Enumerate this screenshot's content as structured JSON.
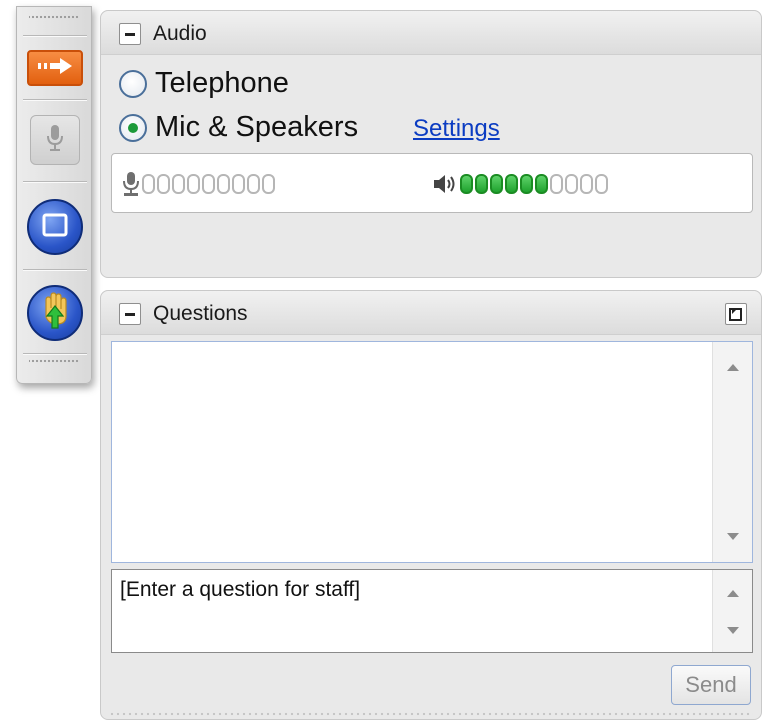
{
  "toolbar": {
    "buttons": [
      {
        "icon": "orange-arrow-icon"
      },
      {
        "icon": "microphone-icon"
      },
      {
        "icon": "window-icon"
      },
      {
        "icon": "raise-hand-icon"
      }
    ]
  },
  "audio": {
    "title": "Audio",
    "options": [
      {
        "label": "Telephone",
        "checked": false
      },
      {
        "label": "Mic & Speakers",
        "checked": true
      }
    ],
    "settings_link": "Settings",
    "mic_meter": {
      "segments": 9,
      "active": 0
    },
    "speaker_meter": {
      "segments": 10,
      "active": 6
    }
  },
  "questions": {
    "title": "Questions",
    "input_value": "[Enter a question for staff]",
    "send_label": "Send"
  },
  "colors": {
    "accent_orange": "#e2600f",
    "toolbar_blue": "#2a55c8",
    "meter_green": "#1fa22e",
    "link_blue": "#0b3cc2"
  }
}
